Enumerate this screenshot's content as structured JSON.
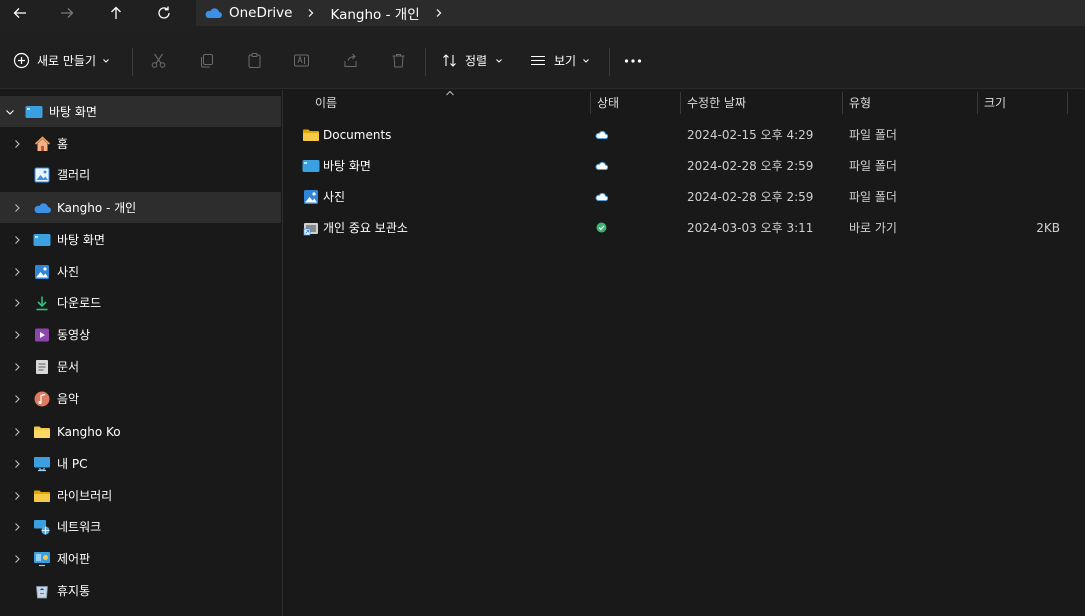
{
  "nav": {
    "back_icon": "arrow-left-icon",
    "forward_icon": "arrow-right-icon",
    "up_icon": "arrow-up-icon",
    "refresh_icon": "refresh-icon"
  },
  "breadcrumb": {
    "items": [
      {
        "label": "OneDrive",
        "icon": "onedrive-cloud-icon"
      },
      {
        "label": "Kangho - 개인"
      }
    ]
  },
  "toolbar": {
    "new_label": "새로 만들기",
    "sort_label": "정렬",
    "view_label": "보기",
    "more_icon": "more-dots-icon"
  },
  "sidebar": {
    "items": [
      {
        "label": "바탕 화면",
        "icon": "desktop-icon",
        "expanded": true
      },
      {
        "label": "홈",
        "icon": "home-icon"
      },
      {
        "label": "갤러리",
        "icon": "gallery-icon"
      },
      {
        "label": "Kangho - 개인",
        "icon": "onedrive-cloud-icon"
      },
      {
        "label": "바탕 화면",
        "icon": "desktop-icon"
      },
      {
        "label": "사진",
        "icon": "pictures-icon"
      },
      {
        "label": "다운로드",
        "icon": "download-icon"
      },
      {
        "label": "동영상",
        "icon": "videos-icon"
      },
      {
        "label": "문서",
        "icon": "documents-icon"
      },
      {
        "label": "음악",
        "icon": "music-icon"
      },
      {
        "label": "Kangho Ko",
        "icon": "folder-icon"
      },
      {
        "label": "내 PC",
        "icon": "pc-icon"
      },
      {
        "label": "라이브러리",
        "icon": "libraries-icon"
      },
      {
        "label": "네트워크",
        "icon": "network-icon"
      },
      {
        "label": "제어판",
        "icon": "control-panel-icon"
      },
      {
        "label": "휴지통",
        "icon": "recycle-bin-icon"
      }
    ]
  },
  "columns": {
    "name": "이름",
    "status": "상태",
    "modified": "수정한 날짜",
    "type": "유형",
    "size": "크기"
  },
  "files": [
    {
      "name": "Documents",
      "icon": "folder-icon",
      "status": "cloud",
      "modified": "2024-02-15 오후 4:29",
      "type": "파일 폴더",
      "size": ""
    },
    {
      "name": "바탕 화면",
      "icon": "desktop-icon",
      "status": "cloud",
      "modified": "2024-02-28 오후 2:59",
      "type": "파일 폴더",
      "size": ""
    },
    {
      "name": "사진",
      "icon": "pictures-icon",
      "status": "cloud",
      "modified": "2024-02-28 오후 2:59",
      "type": "파일 폴더",
      "size": ""
    },
    {
      "name": "개인 중요 보관소",
      "icon": "vault-shortcut-icon",
      "status": "synced",
      "modified": "2024-03-03 오후 3:11",
      "type": "바로 가기",
      "size": "2KB"
    }
  ],
  "colors": {
    "background": "#191919",
    "accent_cloud": "#4aa3df",
    "synced_green": "#3cb371",
    "folder_yellow": "#f7c948"
  }
}
